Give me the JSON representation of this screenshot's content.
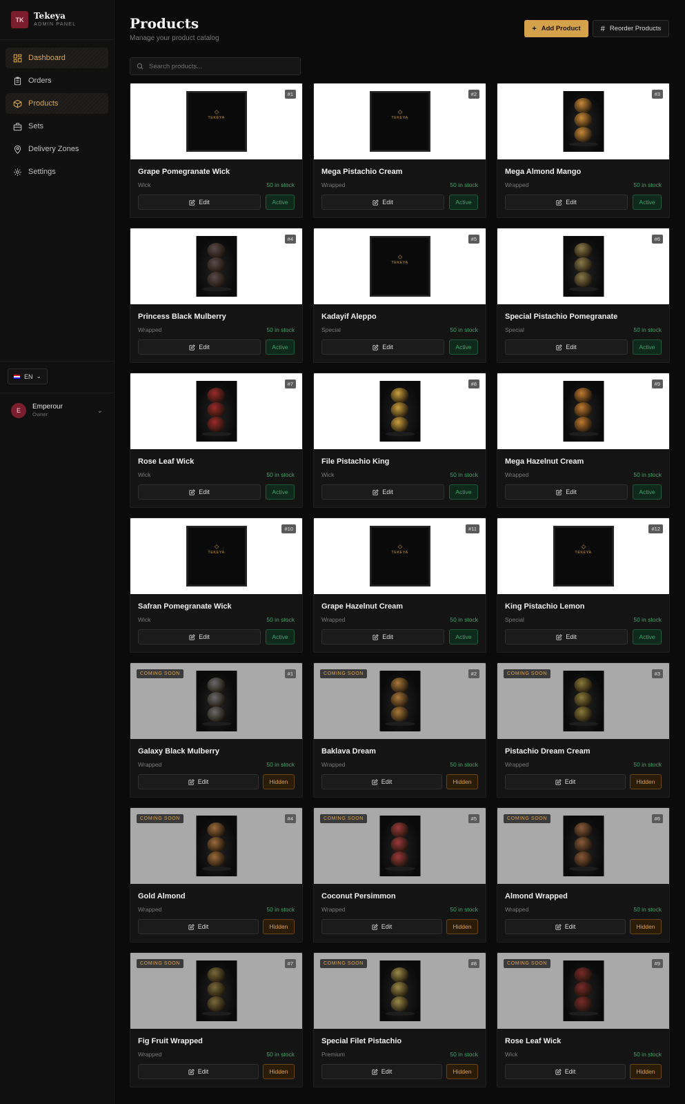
{
  "brand": {
    "logo": "TK",
    "name": "Tekeya",
    "subtitle": "ADMIN PANEL"
  },
  "nav": [
    {
      "label": "Dashboard",
      "icon": "dashboard-icon",
      "active": true
    },
    {
      "label": "Orders",
      "icon": "clipboard-icon",
      "active": false
    },
    {
      "label": "Products",
      "icon": "box-icon",
      "active": true
    },
    {
      "label": "Sets",
      "icon": "gift-icon",
      "active": false
    },
    {
      "label": "Delivery Zones",
      "icon": "map-pin-icon",
      "active": false
    },
    {
      "label": "Settings",
      "icon": "gear-icon",
      "active": false
    }
  ],
  "language": {
    "code": "EN"
  },
  "user": {
    "initial": "E",
    "name": "Emperour",
    "role": "Owner"
  },
  "header": {
    "title": "Products",
    "subtitle": "Manage your product catalog",
    "add_label": "Add Product",
    "reorder_label": "Reorder Products"
  },
  "search": {
    "placeholder": "Search products...",
    "value": ""
  },
  "labels": {
    "edit": "Edit",
    "coming_soon": "COMING SOON"
  },
  "colors": {
    "accent": "#d4a24a",
    "active_green": "#3aa66a",
    "hidden_orange": "#e0a040",
    "brand": "#7a1e2e"
  },
  "products": [
    {
      "num": "#1",
      "name": "Grape Pomegranate Wick",
      "category": "Wick",
      "stock": "50 in stock",
      "status": "Active",
      "coming_soon": false,
      "image": "placeholder"
    },
    {
      "num": "#2",
      "name": "Mega Pistachio Cream",
      "category": "Wrapped",
      "stock": "50 in stock",
      "status": "Active",
      "coming_soon": false,
      "image": "placeholder"
    },
    {
      "num": "#3",
      "name": "Mega Almond Mango",
      "category": "Wrapped",
      "stock": "50 in stock",
      "status": "Active",
      "coming_soon": false,
      "image": "#c98a3a"
    },
    {
      "num": "#4",
      "name": "Princess Black Mulberry",
      "category": "Wrapped",
      "stock": "50 in stock",
      "status": "Active",
      "coming_soon": false,
      "image": "#5a4a48"
    },
    {
      "num": "#5",
      "name": "Kadayif Aleppo",
      "category": "Special",
      "stock": "50 in stock",
      "status": "Active",
      "coming_soon": false,
      "image": "placeholder"
    },
    {
      "num": "#6",
      "name": "Special Pistachio Pomegranate",
      "category": "Special",
      "stock": "50 in stock",
      "status": "Active",
      "coming_soon": false,
      "image": "#8a7a4a"
    },
    {
      "num": "#7",
      "name": "Rose Leaf Wick",
      "category": "Wick",
      "stock": "50 in stock",
      "status": "Active",
      "coming_soon": false,
      "image": "#9a2a2a"
    },
    {
      "num": "#8",
      "name": "File Pistachio King",
      "category": "Wick",
      "stock": "50 in stock",
      "status": "Active",
      "coming_soon": false,
      "image": "#c9a040"
    },
    {
      "num": "#9",
      "name": "Mega Hazelnut Cream",
      "category": "Wrapped",
      "stock": "50 in stock",
      "status": "Active",
      "coming_soon": false,
      "image": "#c07a30"
    },
    {
      "num": "#10",
      "name": "Safran Pomegranate Wick",
      "category": "Wick",
      "stock": "50 in stock",
      "status": "Active",
      "coming_soon": false,
      "image": "placeholder"
    },
    {
      "num": "#11",
      "name": "Grape Hazelnut Cream",
      "category": "Wrapped",
      "stock": "50 in stock",
      "status": "Active",
      "coming_soon": false,
      "image": "placeholder"
    },
    {
      "num": "#12",
      "name": "King Pistachio Lemon",
      "category": "Special",
      "stock": "50 in stock",
      "status": "Active",
      "coming_soon": false,
      "image": "placeholder"
    },
    {
      "num": "#1",
      "name": "Galaxy Black Mulberry",
      "category": "Wrapped",
      "stock": "50 in stock",
      "status": "Hidden",
      "coming_soon": true,
      "image": "#6a6a6a"
    },
    {
      "num": "#2",
      "name": "Baklava Dream",
      "category": "Wrapped",
      "stock": "50 in stock",
      "status": "Hidden",
      "coming_soon": true,
      "image": "#a8783a"
    },
    {
      "num": "#3",
      "name": "Pistachio Dream Cream",
      "category": "Wrapped",
      "stock": "50 in stock",
      "status": "Hidden",
      "coming_soon": true,
      "image": "#8a7a3a"
    },
    {
      "num": "#4",
      "name": "Gold Almond",
      "category": "Wrapped",
      "stock": "50 in stock",
      "status": "Hidden",
      "coming_soon": true,
      "image": "#9a6a3a"
    },
    {
      "num": "#5",
      "name": "Coconut Persimmon",
      "category": "Wrapped",
      "stock": "50 in stock",
      "status": "Hidden",
      "coming_soon": true,
      "image": "#9a3a3a"
    },
    {
      "num": "#6",
      "name": "Almond Wrapped",
      "category": "Wrapped",
      "stock": "50 in stock",
      "status": "Hidden",
      "coming_soon": true,
      "image": "#8a5a3a"
    },
    {
      "num": "#7",
      "name": "Fig Fruit Wrapped",
      "category": "Wrapped",
      "stock": "50 in stock",
      "status": "Hidden",
      "coming_soon": true,
      "image": "#7a6a3a"
    },
    {
      "num": "#8",
      "name": "Special Filet Pistachio",
      "category": "Premium",
      "stock": "50 in stock",
      "status": "Hidden",
      "coming_soon": true,
      "image": "#9a8a4a"
    },
    {
      "num": "#9",
      "name": "Rose Leaf Wick",
      "category": "Wick",
      "stock": "50 in stock",
      "status": "Hidden",
      "coming_soon": true,
      "image": "#7a2a2a"
    }
  ]
}
